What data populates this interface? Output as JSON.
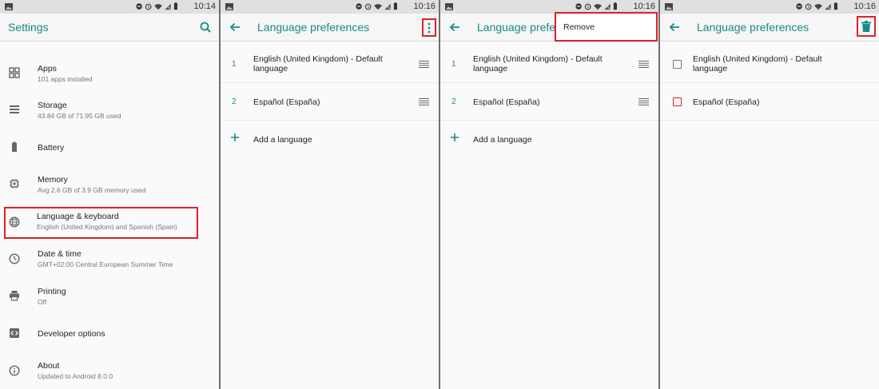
{
  "colors": {
    "accent": "#1a8b86",
    "highlight": "#e0202b"
  },
  "panels": [
    {
      "status_time": "10:14",
      "title": "Settings",
      "items": [
        {
          "icon": "apps-icon",
          "title": "Apps",
          "subtitle": "101 apps installed"
        },
        {
          "icon": "storage-icon",
          "title": "Storage",
          "subtitle": "43.84 GB of 71.95 GB used"
        },
        {
          "icon": "battery-icon",
          "title": "Battery",
          "subtitle": ""
        },
        {
          "icon": "memory-icon",
          "title": "Memory",
          "subtitle": "Avg 2.6 GB of 3.9 GB memory used"
        },
        {
          "icon": "globe-icon",
          "title": "Language & keyboard",
          "subtitle": "English (United Kingdom) and Spanish (Spain)"
        },
        {
          "icon": "clock-icon",
          "title": "Date & time",
          "subtitle": "GMT+02:00 Central European Summer Time"
        },
        {
          "icon": "printer-icon",
          "title": "Printing",
          "subtitle": "Off"
        },
        {
          "icon": "code-icon",
          "title": "Developer options",
          "subtitle": ""
        },
        {
          "icon": "info-icon",
          "title": "About",
          "subtitle": "Updated to Android 8.0.0"
        }
      ]
    },
    {
      "status_time": "10:16",
      "title": "Language preferences",
      "languages": [
        {
          "num": "1",
          "name": "English (United Kingdom) - Default language"
        },
        {
          "num": "2",
          "name": "Español (España)"
        }
      ],
      "add_label": "Add a language"
    },
    {
      "status_time": "10:16",
      "title": "Language preferences",
      "languages": [
        {
          "num": "1",
          "name": "English (United Kingdom) - Default language"
        },
        {
          "num": "2",
          "name": "Español (España)"
        }
      ],
      "add_label": "Add a language",
      "menu_item": "Remove"
    },
    {
      "status_time": "10:16",
      "title": "Language preferences",
      "languages": [
        {
          "name": "English (United Kingdom) - Default language"
        },
        {
          "name": "Español (España)"
        }
      ]
    }
  ]
}
